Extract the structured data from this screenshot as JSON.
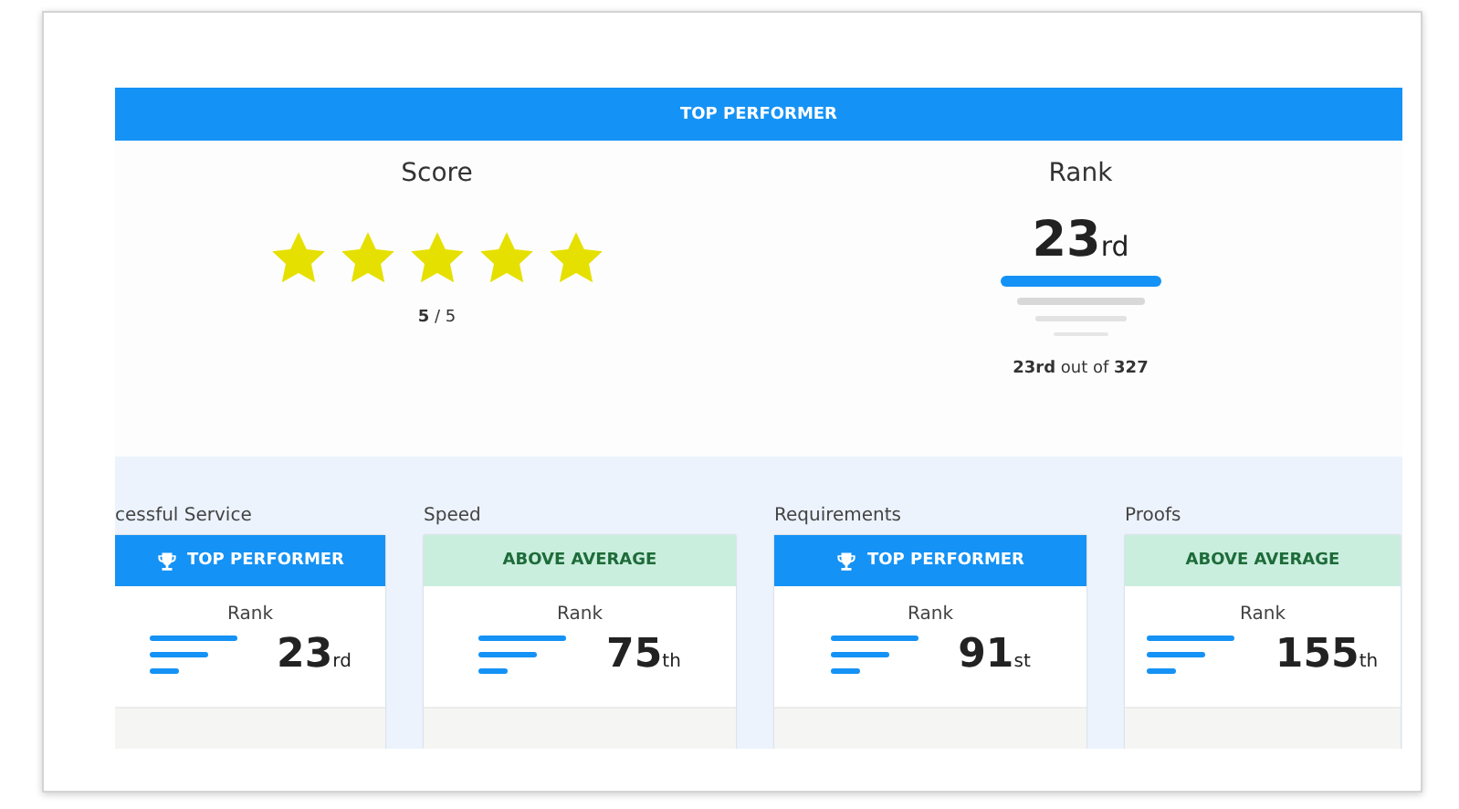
{
  "banner": "TOP PERFORMER",
  "score": {
    "title": "Score",
    "stars": 5,
    "value": "5",
    "total": "/ 5"
  },
  "rank": {
    "title": "Rank",
    "number": "23",
    "suffix": "rd",
    "caption_rank": "23rd",
    "caption_mid": "out of",
    "caption_total": "327"
  },
  "categories": [
    {
      "name": "cessful Service",
      "kind": "top",
      "badge": "TOP PERFORMER",
      "rank_label": "Rank",
      "number": "23",
      "suffix": "rd"
    },
    {
      "name": "Speed",
      "kind": "above",
      "badge": "ABOVE AVERAGE",
      "rank_label": "Rank",
      "number": "75",
      "suffix": "th"
    },
    {
      "name": "Requirements",
      "kind": "top",
      "badge": "TOP PERFORMER",
      "rank_label": "Rank",
      "number": "91",
      "suffix": "st"
    },
    {
      "name": "Proofs",
      "kind": "above",
      "badge": "ABOVE AVERAGE",
      "rank_label": "Rank",
      "number": "155",
      "suffix": "th"
    }
  ]
}
